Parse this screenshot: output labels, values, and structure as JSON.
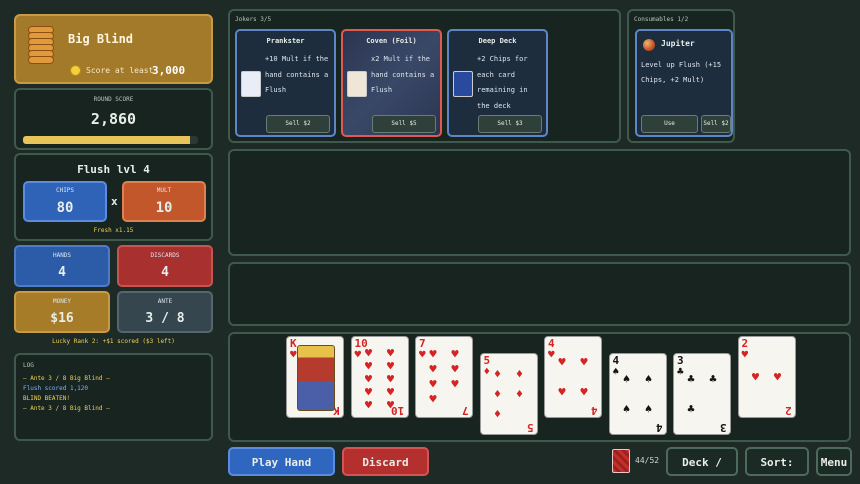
{
  "blind": {
    "title": "Big Blind",
    "score_at_least": "Score at least",
    "target": "3,000"
  },
  "round_score": {
    "label": "ROUND SCORE",
    "value": "2,860",
    "progress": 0.953
  },
  "hand": {
    "name": "Flush  lvl 4",
    "chips_label": "CHIPS",
    "chips": "80",
    "times": "x",
    "mult_label": "MULT",
    "mult": "10",
    "bonus": "Fresh x1.15"
  },
  "stats": {
    "hands_label": "HANDS",
    "hands": "4",
    "discards_label": "DISCARDS",
    "discards": "4",
    "money_label": "MONEY",
    "money": "$16",
    "ante_label": "ANTE",
    "ante": "3 / 8"
  },
  "lucky": "Lucky Rank 2: +$1 scored ($3 left)",
  "log": {
    "title": "LOG",
    "lines": [
      {
        "text": "— Ante 3 / 8 Big Blind —",
        "tone": "yellow"
      },
      {
        "text": "Flush scored 1,120",
        "tone": "blue"
      },
      {
        "text": "BLIND BEATEN!",
        "tone": "yellow"
      },
      {
        "text": "— Ante 3 / 8 Big Blind —",
        "tone": "yellow"
      }
    ]
  },
  "jokers": {
    "title": "Jokers 3/5",
    "items": [
      {
        "name": "Prankster",
        "desc": "+10 Mult if the hand contains a Flush",
        "sell": "Sell $2",
        "art_color": "#e9eef6"
      },
      {
        "name": "Coven (Foil)",
        "desc": "x2 Mult if the hand contains a Flush",
        "sell": "Sell $5",
        "art_color": "#f0e6d8"
      },
      {
        "name": "Deep Deck",
        "desc": "+2 Chips for each card remaining in the deck",
        "sell": "Sell $3",
        "art_color": "#2a4aa0"
      }
    ]
  },
  "consumables": {
    "title": "Consumables 1/2",
    "item": {
      "name": "Jupiter",
      "desc": "Level up Flush (+15 Chips, +2 Mult)",
      "use": "Use",
      "sell": "Sell $2"
    }
  },
  "cards": [
    {
      "rank": "K",
      "suit": "♥",
      "color": "red",
      "pips": 0,
      "raised": true
    },
    {
      "rank": "10",
      "suit": "♥",
      "color": "red",
      "pips": 10,
      "raised": true
    },
    {
      "rank": "7",
      "suit": "♥",
      "color": "red",
      "pips": 7,
      "raised": true
    },
    {
      "rank": "5",
      "suit": "♦",
      "color": "red",
      "pips": 5,
      "raised": false
    },
    {
      "rank": "4",
      "suit": "♥",
      "color": "red",
      "pips": 4,
      "raised": true
    },
    {
      "rank": "4",
      "suit": "♠",
      "color": "blk",
      "pips": 4,
      "raised": false
    },
    {
      "rank": "3",
      "suit": "♣",
      "color": "blk",
      "pips": 3,
      "raised": false
    },
    {
      "rank": "2",
      "suit": "♥",
      "color": "red",
      "pips": 2,
      "raised": true
    }
  ],
  "buttons": {
    "play": "Play Hand",
    "discard": "Discard",
    "deck_info": "Deck / Info",
    "sort": "Sort: Rank",
    "menu": "Menu"
  },
  "deck_count": "44/52"
}
